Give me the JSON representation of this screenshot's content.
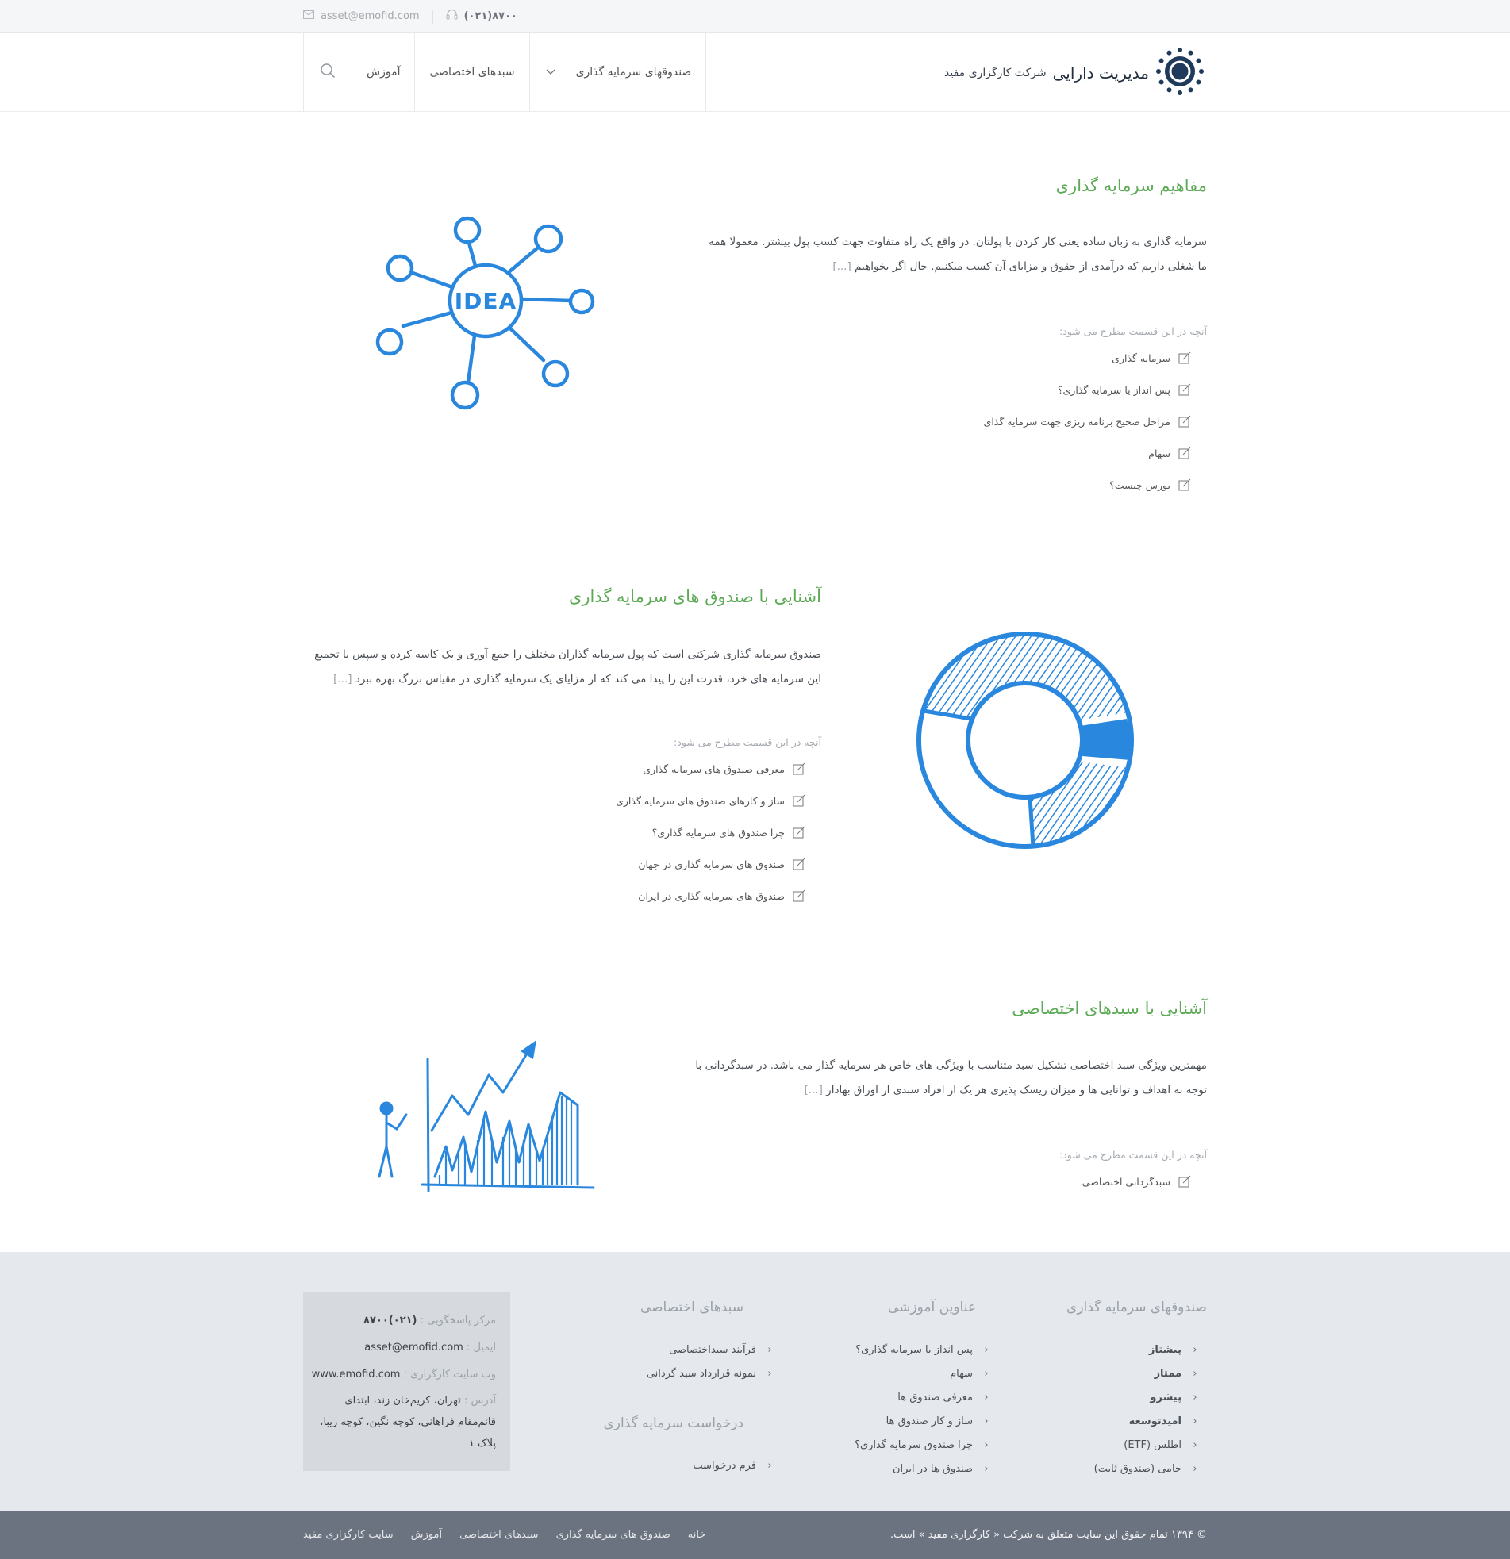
{
  "topbar": {
    "email": "asset@emofid.com",
    "phone": "(۰۲۱)۸۷۰۰"
  },
  "header": {
    "logo_brand": "مدیریت دارایی",
    "logo_sub": "شرکت کارگزاری مفید",
    "nav": [
      {
        "label": "صندوقهای سرمایه گذاری"
      },
      {
        "label": "سبدهای اختصاصی"
      },
      {
        "label": "آموزش"
      }
    ]
  },
  "sections": [
    {
      "title": "مفاهیم سرمایه گذاری",
      "text": "سرمایه گذاری به زبان ساده یعنی کار کردن با پولتان. در واقع یک راه متفاوت جهت کسب پول بیشتر. معمولا همه ما شغلی داریم که درآمدی از حقوق و مزایای آن کسب میکنیم. حال اگر بخواهیم",
      "more": "[...]",
      "topics_label": "آنچه در این قسمت مطرح می شود:",
      "topics": [
        "سرمایه گذاری",
        "پس انداز یا سرمایه گذاری؟",
        "مراحل صحیح برنامه ریزی جهت سرمایه گذای",
        "سهام",
        "بورس چیست؟"
      ]
    },
    {
      "title": "آشنایی با صندوق های سرمایه گذاری",
      "text": "صندوق سرمایه گذاری شرکتی است که پول سرمایه گذاران مختلف را جمع آوری و یک کاسه کرده و سپس با تجمیع این سرمایه های خرد، قدرت این را پیدا می کند که از مزایای یک سرمایه گذاری در مقیاس بزرگ بهره ببرد",
      "more": "[...]",
      "topics_label": "آنچه در این قسمت مطرح می شود:",
      "topics": [
        "معرفی صندوق های سرمایه گذاری",
        "ساز و کارهای صندوق های سرمایه گذاری",
        "چرا صندوق های سرمایه گذاری؟",
        "صندوق های سرمایه گذاری در جهان",
        "صندوق های سرمایه گذاری در ایران"
      ]
    },
    {
      "title": "آشنایی با سبدهای اختصاصی",
      "text": "مهمترین ویژگی سبد اختصاصی تشکیل سبد متناسب با ویژگی های خاص هر سرمایه گذار می باشد. در سبدگردانی با توجه به اهداف و توانایی ها و میزان ریسک پذیری هر یک از افراد سبدی از اوراق بهادار",
      "more": "[...]",
      "topics_label": "آنچه در این قسمت مطرح می شود:",
      "topics": [
        "سبدگردانی اختصاصی"
      ]
    }
  ],
  "footer": {
    "funds": {
      "title": "صندوقهای سرمایه گذاری",
      "items": [
        "پیشتاز",
        "ممتاز",
        "پیشرو",
        "امیدتوسعه",
        "اطلس (ETF)",
        "حامی (صندوق ثابت)"
      ]
    },
    "education": {
      "title": "عناوین آموزشی",
      "items": [
        "پس انداز یا سرمایه گذاری؟",
        "سهام",
        "معرفی صندوق ها",
        "ساز و کار صندوق ها",
        "چرا صندوق سرمایه گذاری؟",
        "صندوق ها در ایران"
      ]
    },
    "baskets": {
      "title": "سبدهای اختصاصی",
      "items": [
        "فرآیند سبداختصاصی",
        "نمونه قرارداد سبد گردانی"
      ]
    },
    "request": {
      "title": "درخواست سرمایه گذاری",
      "items": [
        "فرم درخواست"
      ]
    },
    "contact": {
      "phone_label": "مرکز پاسخگویی :",
      "phone": "(۰۲۱)۸۷۰۰",
      "email_label": "ایمیل :",
      "email": "asset@emofid.com",
      "web_label": "وب سایت کارگزاری :",
      "web": "www.emofid.com",
      "address_label": "آدرس :",
      "address": "تهران، کریم‌خان زند، ابتدای قائم‌مقام فراهانی، کوچه نگین، کوچه زیبا، پلاک ۱"
    }
  },
  "bottom": {
    "copyright": "© ۱۳۹۴ تمام حقوق این سایت متعلق به شرکت « کارگزاری مفید » است.",
    "nav": [
      "خانه",
      "صندوق های سرمایه گذاری",
      "سبدهای اختصاصی",
      "آموزش",
      "سایت کارگزاری مفید"
    ]
  },
  "colors": {
    "accent_green": "#5daa56",
    "illustration_blue": "#2a87de",
    "footer_bg": "#e5e8ec",
    "bottombar_bg": "#6b7280"
  }
}
